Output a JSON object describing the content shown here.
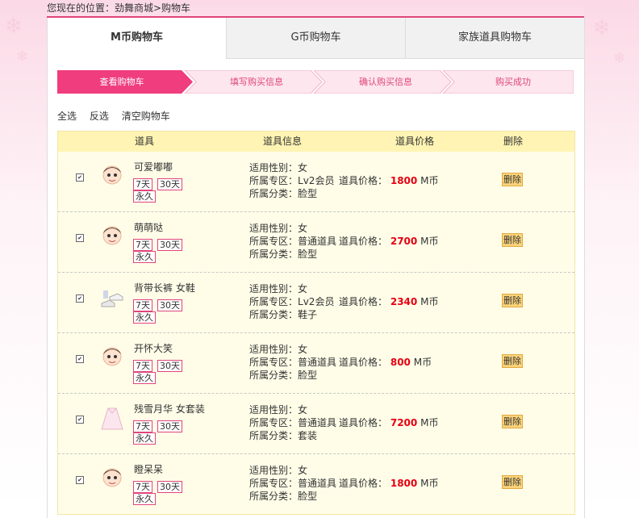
{
  "breadcrumb": "您现在的位置：劲舞商城>购物车",
  "tabs": [
    "M币购物车",
    "G币购物车",
    "家族道具购物车"
  ],
  "steps": [
    "查看购物车",
    "填写购买信息",
    "确认购买信息",
    "购买成功"
  ],
  "actions": [
    "全选",
    "反选",
    "清空购物车"
  ],
  "headers": {
    "item": "道具",
    "info": "道具信息",
    "price": "道具价格",
    "delete": "删除"
  },
  "row_labels": {
    "gender": "适用性别：",
    "zone": "所属专区：",
    "price": "道具价格：",
    "category": "所属分类：",
    "currency": "M币",
    "delete": "删除",
    "d7": "7天",
    "d30": "30天",
    "forever": "永久"
  },
  "items": [
    {
      "name": "可爱嘟嘟",
      "gender": "女",
      "zone": "Lv2会员",
      "price": "1800",
      "category": "脸型",
      "icon": "face-icon",
      "checked": "✔"
    },
    {
      "name": "萌萌哒",
      "gender": "女",
      "zone": "普通道具",
      "price": "2700",
      "category": "脸型",
      "icon": "face-icon",
      "checked": "✔"
    },
    {
      "name": "背带长裤 女鞋",
      "gender": "女",
      "zone": "Lv2会员",
      "price": "2340",
      "category": "鞋子",
      "icon": "shoes-icon",
      "checked": "✔"
    },
    {
      "name": "开怀大笑",
      "gender": "女",
      "zone": "普通道具",
      "price": "800",
      "category": "脸型",
      "icon": "face-icon",
      "checked": "✔"
    },
    {
      "name": "残雪月华 女套装",
      "gender": "女",
      "zone": "普通道具",
      "price": "7200",
      "category": "套装",
      "icon": "dress-icon",
      "checked": "✔"
    },
    {
      "name": "瞪呆呆",
      "gender": "女",
      "zone": "普通道具",
      "price": "1800",
      "category": "脸型",
      "icon": "face-icon",
      "checked": "✔"
    }
  ],
  "colors": {
    "accent": "#ef3d7d",
    "step_bg": "#fde6ee",
    "header_bg": "#fff4b3",
    "row_bg": "#fffde8",
    "price": "#e60012"
  }
}
